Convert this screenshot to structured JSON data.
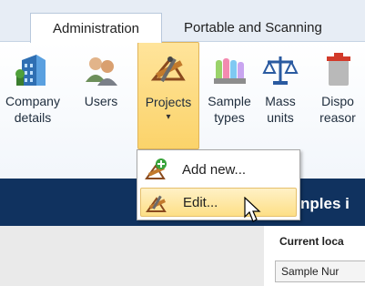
{
  "tabs": [
    {
      "label": "Administration",
      "active": true
    },
    {
      "label": "Portable and Scanning",
      "active": false
    }
  ],
  "ribbon": {
    "buttons": [
      {
        "line1": "Company",
        "line2": "details",
        "icon": "building-icon"
      },
      {
        "line1": "Users",
        "line2": "",
        "icon": "users-icon"
      },
      {
        "line1": "Projects",
        "line2": "▾",
        "icon": "projects-icon",
        "pressed": true
      },
      {
        "line1": "Sample",
        "line2": "types",
        "icon": "sample-types-icon"
      },
      {
        "line1": "Mass",
        "line2": "units",
        "icon": "scales-icon"
      },
      {
        "line1": "Dispo",
        "line2": "reasor",
        "icon": "disposal-icon"
      }
    ]
  },
  "menu": {
    "items": [
      {
        "label": "Add new...",
        "icon": "add-project-icon"
      },
      {
        "label": "Edit...",
        "icon": "edit-project-icon",
        "highlighted": true
      }
    ]
  },
  "band": {
    "title": "nples i"
  },
  "lower": {
    "location_label": "Current loca",
    "field_value": "Sample Nur"
  },
  "colors": {
    "band": "#10325f",
    "pressed": "#fbd36a",
    "highlight": "#fddf86"
  }
}
